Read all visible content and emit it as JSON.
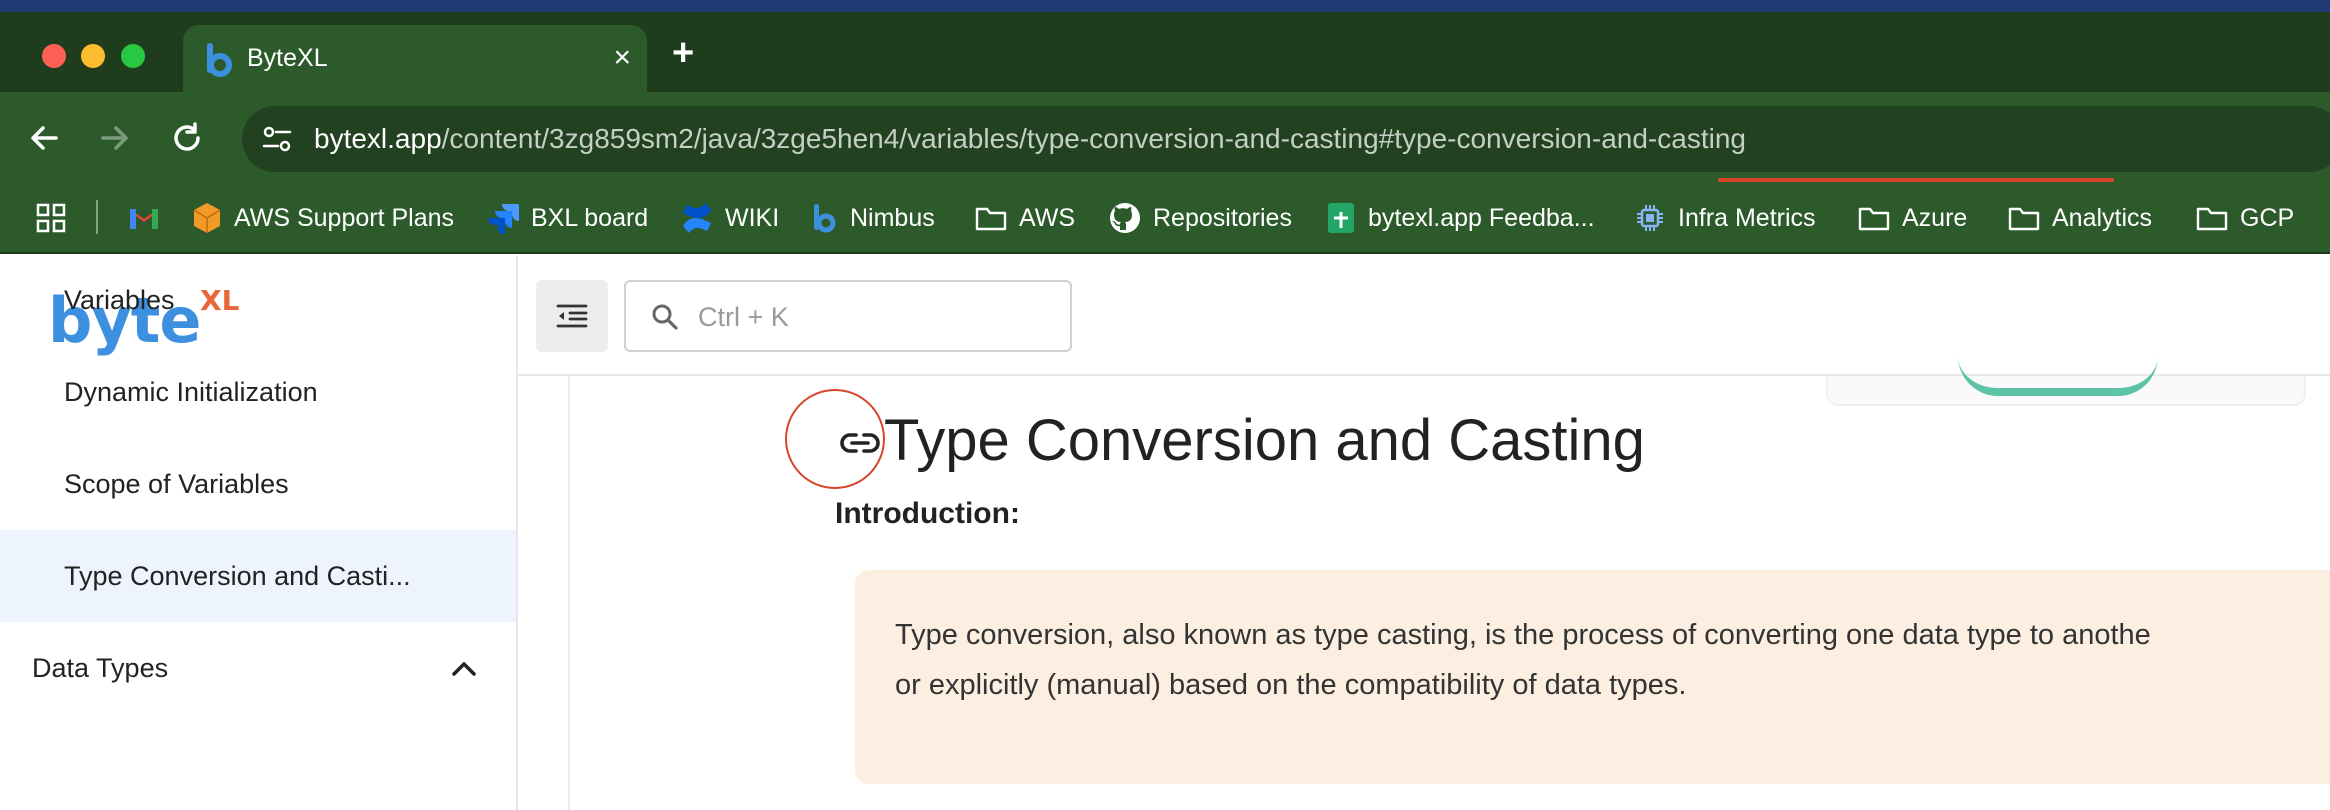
{
  "browser": {
    "tab_title": "ByteXL",
    "tab_close": "×",
    "new_tab": "+",
    "url_host": "bytexl.app",
    "url_path": "/content/3zg859sm2/java/3zge5hen4/variables/type-conversion-and-casting#type-conversion-and-casting",
    "bookmarks": [
      {
        "label": "",
        "icon": "apps-grid-icon"
      },
      {
        "label": "",
        "icon": "gmail-icon"
      },
      {
        "label": "AWS Support Plans",
        "icon": "aws-cube-icon"
      },
      {
        "label": "BXL board",
        "icon": "jira-icon"
      },
      {
        "label": "WIKI",
        "icon": "confluence-icon"
      },
      {
        "label": "Nimbus",
        "icon": "bytexl-b-icon"
      },
      {
        "label": "AWS",
        "icon": "folder-icon"
      },
      {
        "label": "Repositories",
        "icon": "github-icon"
      },
      {
        "label": "bytexl.app Feedba...",
        "icon": "google-sheets-icon"
      },
      {
        "label": "Infra Metrics",
        "icon": "chip-icon"
      },
      {
        "label": "Azure",
        "icon": "folder-icon"
      },
      {
        "label": "Analytics",
        "icon": "folder-icon"
      },
      {
        "label": "GCP",
        "icon": "folder-icon"
      }
    ]
  },
  "sidebar": {
    "logo_main": "byte",
    "logo_sup": "XL",
    "items": [
      {
        "label": "Variables",
        "active": false
      },
      {
        "label": "Dynamic Initialization",
        "active": false
      },
      {
        "label": "Scope of Variables",
        "active": false
      },
      {
        "label": "Type Conversion and Casti...",
        "active": true
      }
    ],
    "section": {
      "label": "Data Types",
      "expanded": true
    }
  },
  "main": {
    "search_placeholder": "Ctrl + K",
    "heading": "Type Conversion and Casting",
    "subheading": "Introduction:",
    "callout_line1": "Type conversion, also known as type casting, is the process of converting one data type to anothe",
    "callout_line2": "or explicitly (manual) based on the compatibility of data types."
  },
  "colors": {
    "chrome_dark": "#1f3d1d",
    "chrome": "#2d5a2b",
    "logo_blue": "#3d8fe0",
    "logo_orange": "#e8663a",
    "callout_bg": "#fcefe2",
    "annotation_red": "#d8452b"
  }
}
